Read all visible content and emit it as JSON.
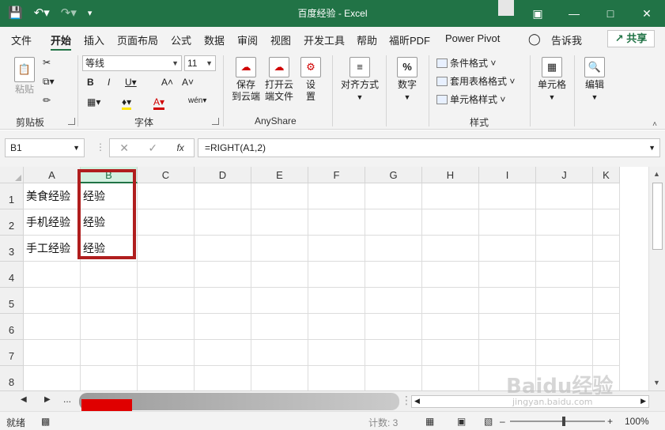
{
  "window": {
    "title": "百度经验  -  Excel",
    "save_icon": "save-icon",
    "undo_icon": "undo-icon",
    "redo_icon": "redo-icon"
  },
  "tabs": [
    "文件",
    "开始",
    "插入",
    "页面布局",
    "公式",
    "数据",
    "审阅",
    "视图",
    "开发工具",
    "帮助",
    "福昕PDF",
    "Power Pivot"
  ],
  "tell_me": "告诉我",
  "share": "共享",
  "ribbon": {
    "clipboard": {
      "paste": "粘贴",
      "label": "剪贴板"
    },
    "font": {
      "name": "等线",
      "size": "11",
      "label": "字体"
    },
    "anyshare": {
      "save_cloud": [
        "保存",
        "到云端"
      ],
      "open_cloud": [
        "打开云",
        "端文件"
      ],
      "settings": [
        "设",
        "置"
      ],
      "label": "AnyShare"
    },
    "alignment": "对齐方式",
    "number": "数字",
    "styles": {
      "conditional": "条件格式",
      "table": "套用表格格式",
      "cell": "单元格样式",
      "label": "样式"
    },
    "cells": "单元格",
    "editing": "编辑"
  },
  "formula_bar": {
    "name_box": "B1",
    "formula": "=RIGHT(A1,2)"
  },
  "grid": {
    "columns": [
      "A",
      "B",
      "C",
      "D",
      "E",
      "F",
      "G",
      "H",
      "I",
      "J",
      "K"
    ],
    "selected_column": "B",
    "rows": [
      "1",
      "2",
      "3",
      "4",
      "5",
      "6",
      "7",
      "8"
    ],
    "cells": [
      [
        "美食经验",
        "经验"
      ],
      [
        "手机经验",
        "经验"
      ],
      [
        "手工经验",
        "经验"
      ]
    ]
  },
  "status": {
    "ready": "就绪",
    "count": "计数: 3",
    "zoom": "100%"
  },
  "watermark": {
    "brand": "Baidu经验",
    "url": "jingyan.baidu.com"
  },
  "colors": {
    "accent": "#217346",
    "highlight": "#b01e1e"
  }
}
